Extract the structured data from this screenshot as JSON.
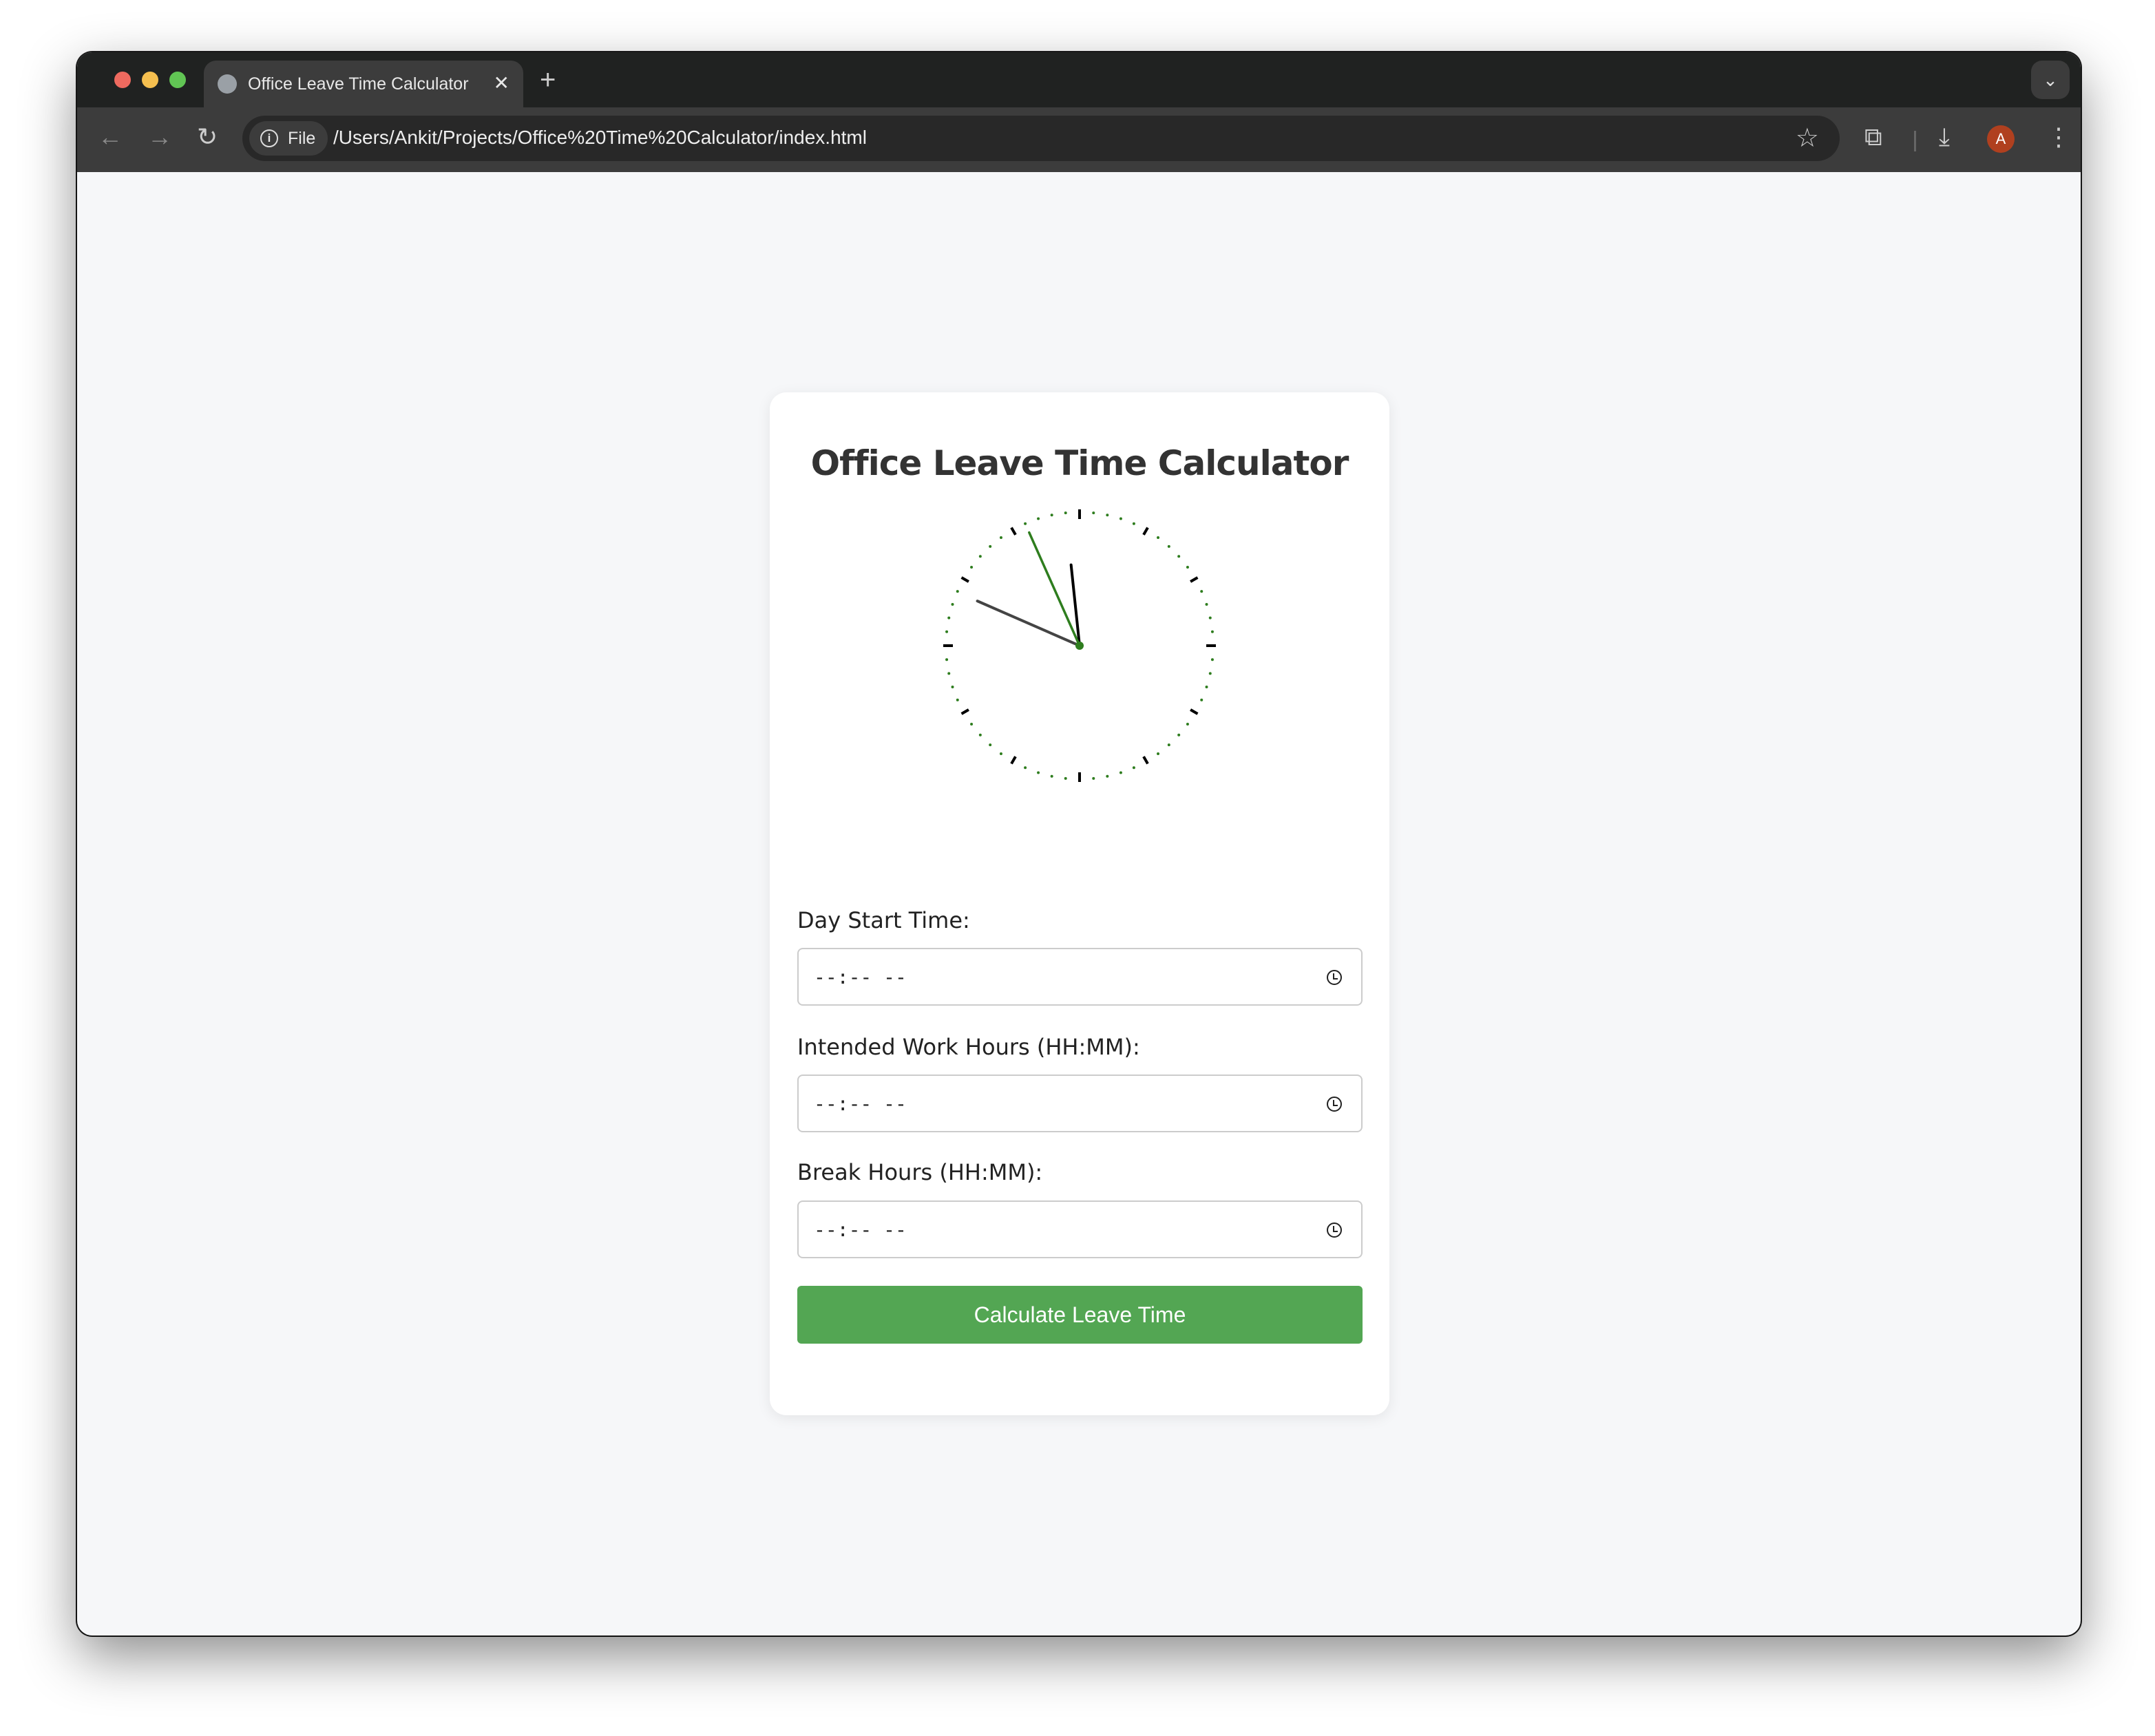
{
  "browser": {
    "tab_title": "Office Leave Time Calculator",
    "close_glyph": "✕",
    "newtab_glyph": "+",
    "chip_label": "File",
    "url": "/Users/Ankit/Projects/Office%20Time%20Calculator/index.html",
    "avatar_letter": "A"
  },
  "page": {
    "title": "Office Leave Time Calculator",
    "clock": {
      "hour": 11,
      "minute": 48,
      "second": 56,
      "accent": "#2e7d1e"
    },
    "fields": [
      {
        "label": "Day Start Time:",
        "value": "--:-- --"
      },
      {
        "label": "Intended Work Hours (HH:MM):",
        "value": "--:-- --"
      },
      {
        "label": "Break Hours (HH:MM):",
        "value": "--:-- --"
      }
    ],
    "button_label": "Calculate Leave Time",
    "button_color": "#53a653"
  }
}
